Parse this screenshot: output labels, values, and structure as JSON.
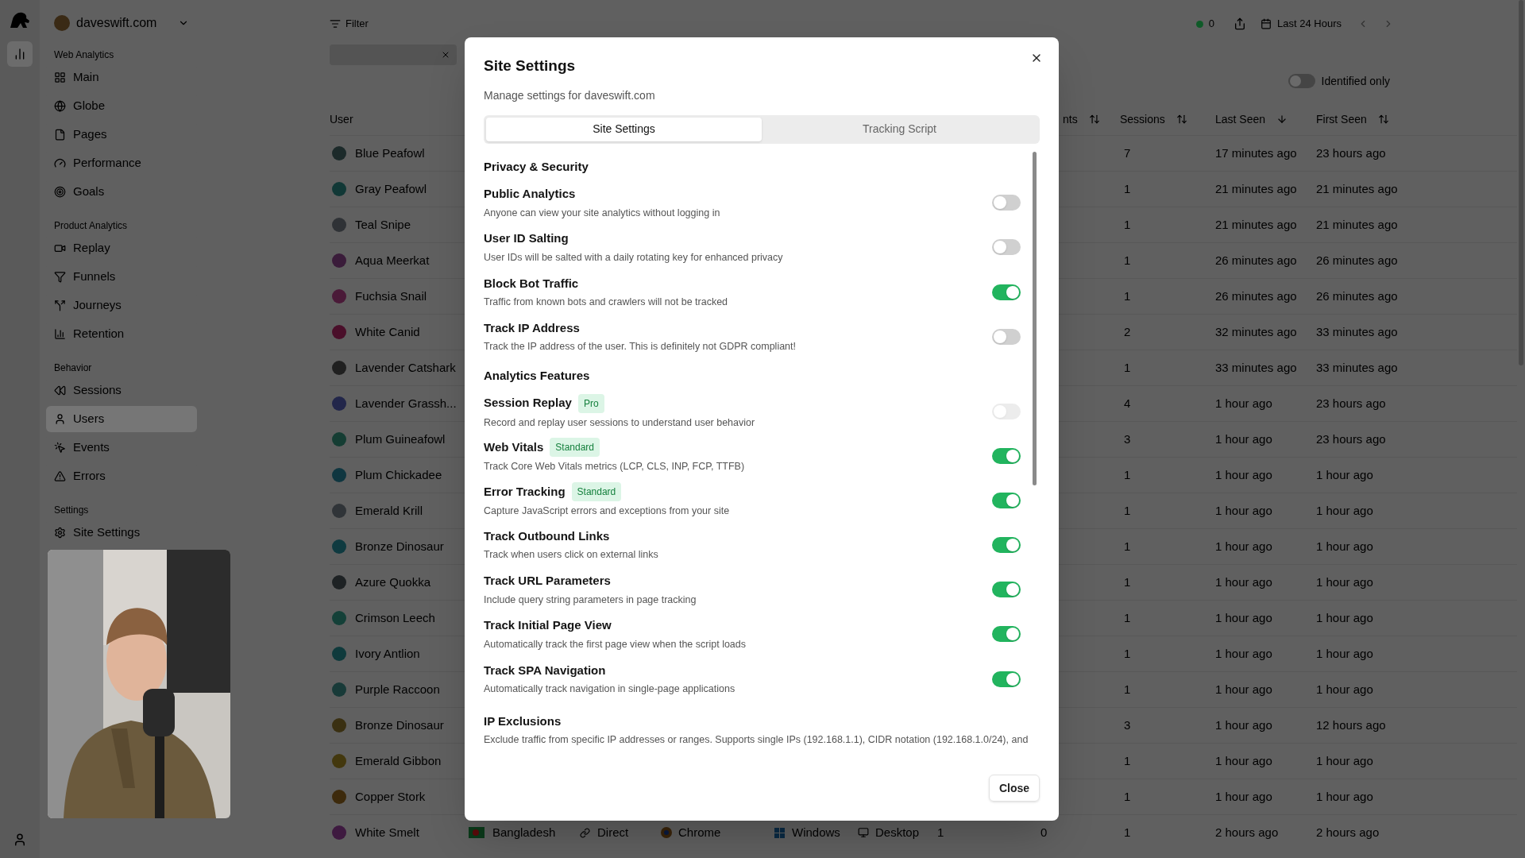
{
  "sidebar": {
    "site": "daveswift.com",
    "sections": [
      {
        "title": "Web Analytics",
        "items": [
          {
            "label": "Main",
            "selected": false
          },
          {
            "label": "Globe",
            "selected": false
          },
          {
            "label": "Pages",
            "selected": false
          },
          {
            "label": "Performance",
            "selected": false
          },
          {
            "label": "Goals",
            "selected": false
          }
        ]
      },
      {
        "title": "Product Analytics",
        "items": [
          {
            "label": "Replay",
            "selected": false
          },
          {
            "label": "Funnels",
            "selected": false
          },
          {
            "label": "Journeys",
            "selected": false
          },
          {
            "label": "Retention",
            "selected": false
          }
        ]
      },
      {
        "title": "Behavior",
        "items": [
          {
            "label": "Sessions",
            "selected": false
          },
          {
            "label": "Users",
            "selected": true
          },
          {
            "label": "Events",
            "selected": false
          },
          {
            "label": "Errors",
            "selected": false
          }
        ]
      },
      {
        "title": "Settings",
        "items": [
          {
            "label": "Site Settings",
            "selected": false
          }
        ]
      }
    ]
  },
  "toolbar": {
    "filter": "Filter",
    "live_count": "0",
    "date_range": "Last 24 Hours",
    "identified_only": {
      "label": "Identified only",
      "on": false
    }
  },
  "table": {
    "columns": [
      {
        "label": "User"
      },
      {
        "label": "nts",
        "sorted": false
      },
      {
        "label": "Sessions",
        "sorted": false
      },
      {
        "label": "Last Seen",
        "sorted": true
      },
      {
        "label": "First Seen",
        "sorted": false
      }
    ],
    "rows": [
      {
        "user": "Blue Peafowl",
        "color": "#1c2a2a",
        "sessions": "7",
        "last_seen": "17 minutes ago",
        "first_seen": "23 hours ago"
      },
      {
        "user": "Gray Peafowl",
        "color": "#113836",
        "sessions": "1",
        "last_seen": "21 minutes ago",
        "first_seen": "21 minutes ago"
      },
      {
        "user": "Teal Snipe",
        "color": "#2f3236",
        "sessions": "1",
        "last_seen": "21 minutes ago",
        "first_seen": "21 minutes ago"
      },
      {
        "user": "Aqua Meerkat",
        "color": "#3a1c3a",
        "sessions": "1",
        "last_seen": "26 minutes ago",
        "first_seen": "26 minutes ago"
      },
      {
        "user": "Fuchsia Snail",
        "color": "#4a1a38",
        "sessions": "1",
        "last_seen": "26 minutes ago",
        "first_seen": "26 minutes ago"
      },
      {
        "user": "White Canid",
        "color": "#4a0f2a",
        "sessions": "2",
        "last_seen": "32 minutes ago",
        "first_seen": "33 minutes ago"
      },
      {
        "user": "Lavender Catshark",
        "color": "#202020",
        "sessions": "1",
        "last_seen": "33 minutes ago",
        "first_seen": "33 minutes ago"
      },
      {
        "user": "Lavender Grassh...",
        "color": "#22264a",
        "sessions": "4",
        "last_seen": "1 hour ago",
        "first_seen": "23 hours ago"
      },
      {
        "user": "Plum Guineafowl",
        "color": "#153d33",
        "sessions": "3",
        "last_seen": "1 hour ago",
        "first_seen": "23 hours ago"
      },
      {
        "user": "Plum Chickadee",
        "color": "#0f3640",
        "sessions": "1",
        "last_seen": "1 hour ago",
        "first_seen": "1 hour ago"
      },
      {
        "user": "Emerald Krill",
        "color": "#303438",
        "sessions": "1",
        "last_seen": "1 hour ago",
        "first_seen": "1 hour ago"
      },
      {
        "user": "Bronze Dinosaur",
        "color": "#0f3a40",
        "sessions": "1",
        "last_seen": "1 hour ago",
        "first_seen": "1 hour ago"
      },
      {
        "user": "Azure Quokka",
        "color": "#1e2224",
        "sessions": "1",
        "last_seen": "1 hour ago",
        "first_seen": "1 hour ago"
      },
      {
        "user": "Crimson Leech",
        "color": "#144038",
        "sessions": "1",
        "last_seen": "1 hour ago",
        "first_seen": "1 hour ago"
      },
      {
        "user": "Ivory Antlion",
        "color": "#0f3a3c",
        "sessions": "1",
        "last_seen": "1 hour ago",
        "first_seen": "1 hour ago"
      },
      {
        "user": "Purple Raccoon",
        "color": "#183a38",
        "sessions": "1",
        "last_seen": "1 hour ago",
        "first_seen": "1 hour ago"
      },
      {
        "user": "Bronze Dinosaur",
        "color": "#3a3012",
        "sessions": "3",
        "last_seen": "1 hour ago",
        "first_seen": "12 hours ago"
      },
      {
        "user": "Emerald Gibbon",
        "color": "#43380e",
        "sessions": "1",
        "last_seen": "1 hour ago",
        "first_seen": "1 hour ago"
      },
      {
        "user": "Copper Stork",
        "color": "#3d2a0c",
        "sessions": "1",
        "last_seen": "1 hour ago",
        "first_seen": "1 hour ago"
      },
      {
        "user": "White Smelt",
        "color": "#3e1a40",
        "country": "Bangladesh",
        "referrer": "Direct",
        "browser": "Chrome",
        "os": "Windows",
        "device": "Desktop",
        "column_7": "1",
        "events": "0",
        "sessions": "1",
        "last_seen": "2 hours ago",
        "first_seen": "2 hours ago"
      }
    ]
  },
  "dialog": {
    "title": "Site Settings",
    "subtitle": "Manage settings for daveswift.com",
    "tabs": [
      {
        "label": "Site Settings",
        "selected": true
      },
      {
        "label": "Tracking Script",
        "selected": false
      }
    ],
    "sections": [
      {
        "title": "Privacy & Security",
        "items": [
          {
            "kind": "toggle",
            "title": "Public Analytics",
            "description": "Anyone can view your site analytics without logging in",
            "on": false,
            "disabled": false
          },
          {
            "kind": "toggle",
            "title": "User ID Salting",
            "description": "User IDs will be salted with a daily rotating key for enhanced privacy",
            "on": false,
            "disabled": false
          },
          {
            "kind": "toggle",
            "title": "Block Bot Traffic",
            "description": "Traffic from known bots and crawlers will not be tracked",
            "on": true,
            "disabled": false
          },
          {
            "kind": "toggle",
            "title": "Track IP Address",
            "description": "Track the IP address of the user. This is definitely not GDPR compliant!",
            "on": false,
            "disabled": false
          }
        ]
      },
      {
        "title": "Analytics Features",
        "items": [
          {
            "kind": "toggle",
            "title": "Session Replay",
            "badge": "Pro",
            "description": "Record and replay user sessions to understand user behavior",
            "on": false,
            "disabled": true
          },
          {
            "kind": "toggle",
            "title": "Web Vitals",
            "badge": "Standard",
            "description": "Track Core Web Vitals metrics (LCP, CLS, INP, FCP, TTFB)",
            "on": true,
            "disabled": false
          },
          {
            "kind": "toggle",
            "title": "Error Tracking",
            "badge": "Standard",
            "description": "Capture JavaScript errors and exceptions from your site",
            "on": true,
            "disabled": false
          },
          {
            "kind": "toggle",
            "title": "Track Outbound Links",
            "description": "Track when users click on external links",
            "on": true,
            "disabled": false
          },
          {
            "kind": "toggle",
            "title": "Track URL Parameters",
            "description": "Include query string parameters in page tracking",
            "on": true,
            "disabled": false
          },
          {
            "kind": "toggle",
            "title": "Track Initial Page View",
            "description": "Automatically track the first page view when the script loads",
            "on": true,
            "disabled": false
          },
          {
            "kind": "toggle",
            "title": "Track SPA Navigation",
            "description": "Automatically track navigation in single-page applications",
            "on": true,
            "disabled": false
          },
          {
            "kind": "info",
            "title": "IP Exclusions",
            "description": "Exclude traffic from specific IP addresses or ranges. Supports single IPs (192.168.1.1), CIDR notation (192.168.1.0/24), and"
          }
        ]
      }
    ],
    "close_button": "Close"
  }
}
